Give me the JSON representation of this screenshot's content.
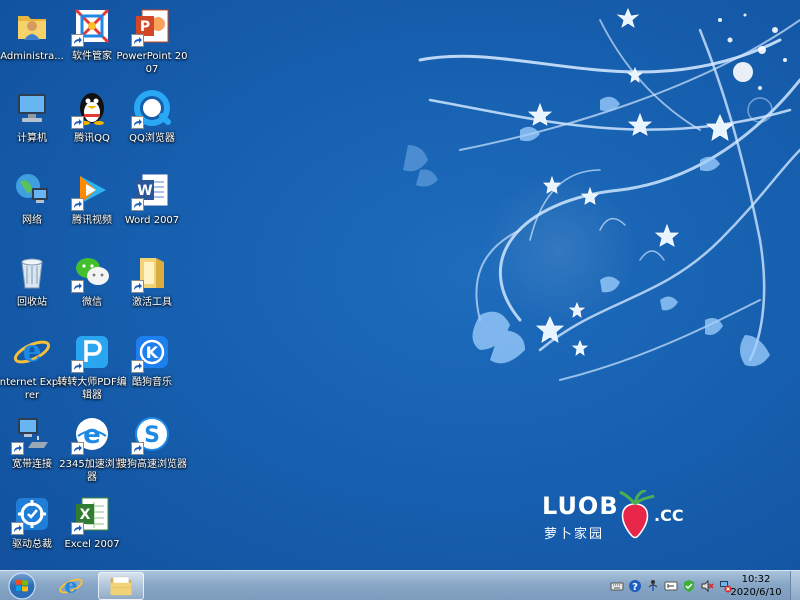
{
  "desktop": {
    "icons": [
      {
        "label": "Administra...",
        "icon": "user-folder-icon",
        "shortcut": false
      },
      {
        "label": "软件管家",
        "icon": "software-manager-icon",
        "shortcut": true
      },
      {
        "label": "PowerPoint 2007",
        "icon": "powerpoint-icon",
        "shortcut": true
      },
      {
        "label": "计算机",
        "icon": "computer-icon",
        "shortcut": false
      },
      {
        "label": "腾讯QQ",
        "icon": "qq-penguin-icon",
        "shortcut": true
      },
      {
        "label": "QQ浏览器",
        "icon": "qq-browser-icon",
        "shortcut": true
      },
      {
        "label": "网络",
        "icon": "network-icon",
        "shortcut": false
      },
      {
        "label": "腾讯视频",
        "icon": "tencent-video-icon",
        "shortcut": true
      },
      {
        "label": "Word 2007",
        "icon": "word-icon",
        "shortcut": true
      },
      {
        "label": "回收站",
        "icon": "recycle-bin-icon",
        "shortcut": false
      },
      {
        "label": "微信",
        "icon": "wechat-icon",
        "shortcut": true
      },
      {
        "label": "激活工具",
        "icon": "folder-tool-icon",
        "shortcut": true
      },
      {
        "label": "Internet Explorer",
        "icon": "internet-explorer-icon",
        "shortcut": false
      },
      {
        "label": "转转大师PDF编辑器",
        "icon": "pdf-editor-icon",
        "shortcut": true
      },
      {
        "label": "酷狗音乐",
        "icon": "kugou-music-icon",
        "shortcut": true
      },
      {
        "label": "宽带连接",
        "icon": "broadband-connection-icon",
        "shortcut": true
      },
      {
        "label": "2345加速浏览器",
        "icon": "browser-2345-icon",
        "shortcut": true
      },
      {
        "label": "搜狗高速浏览器",
        "icon": "sogou-browser-icon",
        "shortcut": true
      },
      {
        "label": "驱动总裁",
        "icon": "driver-tool-icon",
        "shortcut": true
      },
      {
        "label": "Excel 2007",
        "icon": "excel-icon",
        "shortcut": true
      }
    ]
  },
  "logo": {
    "brand": "LUOB",
    "domain": ".CC",
    "subtitle": "萝卜家园"
  },
  "taskbar": {
    "start_icon": "windows-start-orb-icon",
    "pinned": [
      {
        "name": "Internet Explorer",
        "icon": "internet-explorer-icon",
        "active": false
      },
      {
        "name": "Windows Explorer",
        "icon": "windows-explorer-icon",
        "active": true
      }
    ],
    "tray_icons": [
      "keyboard-icon",
      "help-icon",
      "network-status-icon",
      "language-icon",
      "security-shield-icon",
      "volume-muted-icon",
      "network-error-icon"
    ],
    "clock": {
      "time": "10:32",
      "date": "2020/6/10"
    }
  },
  "colors": {
    "desktop_background": "#1760b0",
    "taskbar": "#88a7c6",
    "icon_label_text": "#ffffff"
  }
}
